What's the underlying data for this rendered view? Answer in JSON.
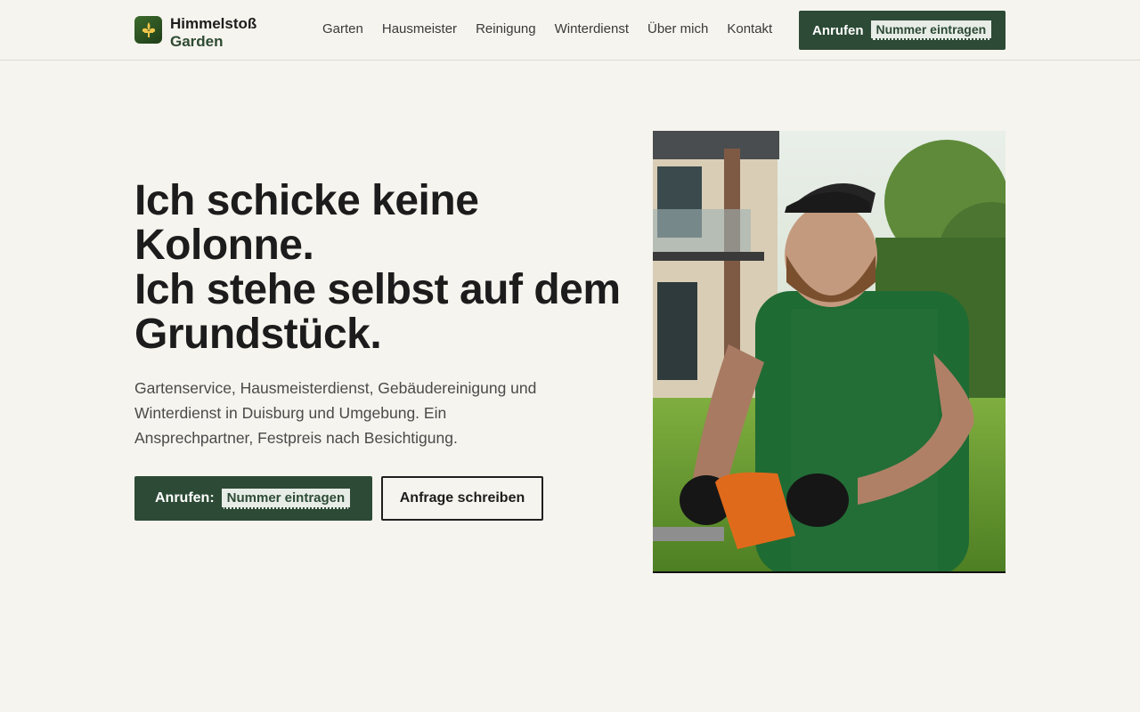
{
  "brand": {
    "name_line1": "Himmelstoß",
    "name_line2": "Garden",
    "icon": "fleur-de-lis-icon"
  },
  "nav": {
    "items": [
      "Garten",
      "Hausmeister",
      "Reinigung",
      "Winterdienst",
      "Über mich",
      "Kontakt"
    ]
  },
  "header_cta": {
    "label": "Anrufen",
    "number_placeholder": "Nummer eintragen"
  },
  "hero": {
    "title_lines": [
      "Ich schicke keine",
      "Kolonne.",
      "Ich stehe selbst auf dem",
      "Grundstück."
    ],
    "text": "Gartenservice, Hausmeisterdienst, Gebäudereinigung und Winterdienst in Duisburg und Umgebung. Ein Ansprechpartner, Festpreis nach Besichtigung.",
    "primary_label": "Anrufen:",
    "primary_number_placeholder": "Nummer eintragen",
    "secondary_label": "Anfrage schreiben"
  },
  "colors": {
    "accent": "#2c4a35",
    "background": "#f6f4ee",
    "text": "#1c1c1c"
  }
}
